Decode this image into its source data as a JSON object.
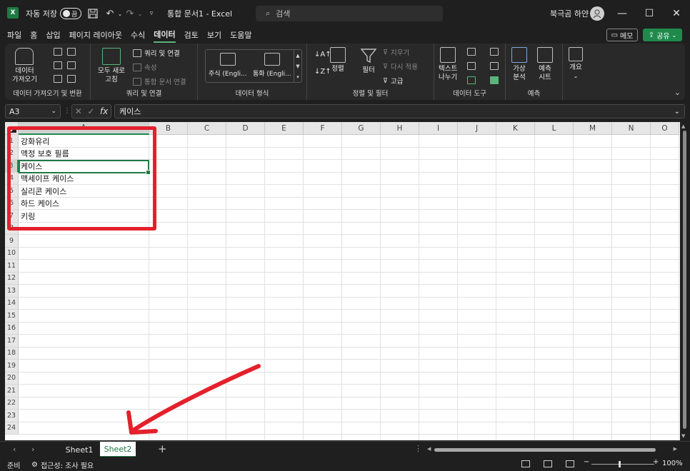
{
  "titlebar": {
    "logo": "X",
    "autosave_label": "자동 저장",
    "autosave_state": "끔",
    "doc_title": "통합 문서1  -  Excel",
    "search_placeholder": "검색",
    "user_name": "북극곰 하얀",
    "icons": [
      "save-icon",
      "undo-icon",
      "redo-icon",
      "customize-icon",
      "search-icon",
      "minimize-icon",
      "maximize-icon",
      "close-icon"
    ]
  },
  "tabs": [
    "파일",
    "홈",
    "삽입",
    "페이지 레이아웃",
    "수식",
    "데이터",
    "검토",
    "보기",
    "도움말"
  ],
  "active_tab": "데이터",
  "memo_label": "메모",
  "share_label": "공유",
  "ribbon": {
    "get_data": {
      "line1": "데이터",
      "line2": "가져오기",
      "group": "데이터 가져오기 및 변환"
    },
    "refresh_all": {
      "line1": "모두 새로",
      "line2": "고침"
    },
    "queries_connections": "쿼리 및 연결",
    "properties": "속성",
    "edit_links": "통합 문서 연결",
    "queries_group": "쿼리 및 연결",
    "stocks": "주식 (Engli...",
    "currencies": "통화 (Engli...",
    "datatypes_group": "데이터 형식",
    "sort": "정렬",
    "filter": "필터",
    "clear": "지우기",
    "reapply": "다시 적용",
    "advanced": "고급",
    "sortfilter_group": "정렬 및 필터",
    "text_to_columns": {
      "line1": "텍스트",
      "line2": "나누기"
    },
    "datatools_group": "데이터 도구",
    "whatif": {
      "line1": "가상",
      "line2": "분석"
    },
    "forecast_sheet": {
      "line1": "예측",
      "line2": "시트"
    },
    "forecast_group": "예측",
    "outline": "개요"
  },
  "formula_bar": {
    "name_box": "A3",
    "fx": "fx",
    "content": "케이스"
  },
  "columns": [
    "A",
    "B",
    "C",
    "D",
    "E",
    "F",
    "G",
    "H",
    "I",
    "J",
    "K",
    "L",
    "M",
    "N",
    "O"
  ],
  "selected_column": "A",
  "rows": [
    "1",
    "2",
    "3",
    "4",
    "5",
    "6",
    "7",
    "8",
    "9",
    "10",
    "11",
    "12",
    "13",
    "14",
    "15",
    "16",
    "17",
    "18",
    "19",
    "20",
    "21",
    "22",
    "23",
    "24"
  ],
  "selected_row": "3",
  "cells_A": [
    "강화유리",
    "액정 보호 필름",
    "케이스",
    "맥세이프 케이스",
    "실리콘 케이스",
    "하드 케이스",
    "키링"
  ],
  "sheets": [
    "Sheet1",
    "Sheet2"
  ],
  "active_sheet": "Sheet2",
  "status": {
    "ready": "준비",
    "accessibility": "접근성: 조사 필요",
    "zoom": "100%"
  },
  "colors": {
    "excel_green": "#1f7a44",
    "annotation_red": "#e5202b"
  }
}
